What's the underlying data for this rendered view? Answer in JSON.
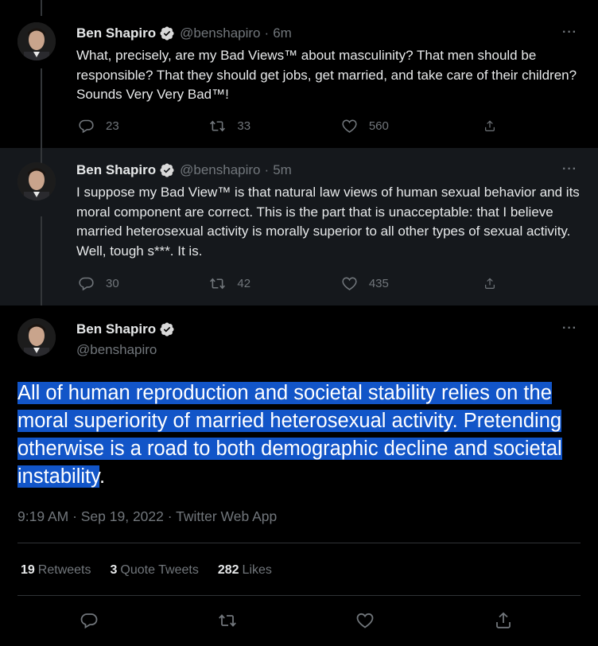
{
  "tweets": [
    {
      "name": "Ben Shapiro",
      "handle": "@benshapiro",
      "time": "6m",
      "text": "What, precisely, are my Bad Views™ about masculinity? That men should be responsible? That they should get jobs, get married, and take care of their children? Sounds Very Very Bad™!",
      "replies": "23",
      "retweets": "33",
      "likes": "560"
    },
    {
      "name": "Ben Shapiro",
      "handle": "@benshapiro",
      "time": "5m",
      "text": "I suppose my Bad View™ is that natural law views of human sexual behavior and its moral component are correct. This is the part that is unacceptable: that I believe married heterosexual activity is morally superior to all other types of sexual activity. Well, tough s***. It is.",
      "replies": "30",
      "retweets": "42",
      "likes": "435"
    }
  ],
  "main_tweet": {
    "name": "Ben Shapiro",
    "handle": "@benshapiro",
    "text": "All of human reproduction and societal stability relies on the moral superiority of married heterosexual activity. Pretending otherwise is a road to both demographic decline and societal instability",
    "text_end": ".",
    "timestamp": "9:19 AM · Sep 19, 2022 · Twitter Web App",
    "stats": {
      "retweets_count": "19",
      "retweets_label": "Retweets",
      "quotes_count": "3",
      "quotes_label": "Quote Tweets",
      "likes_count": "282",
      "likes_label": "Likes"
    }
  },
  "meta_separator": "·",
  "more_label": "···",
  "icons": [
    "reply-icon",
    "retweet-icon",
    "like-icon",
    "share-icon",
    "verified-badge-icon",
    "more-icon"
  ],
  "colors": {
    "background": "#000000",
    "highlight": "#1255c8",
    "muted": "#71767b",
    "text": "#e7e9ea",
    "verified": "#d9d9d9"
  }
}
